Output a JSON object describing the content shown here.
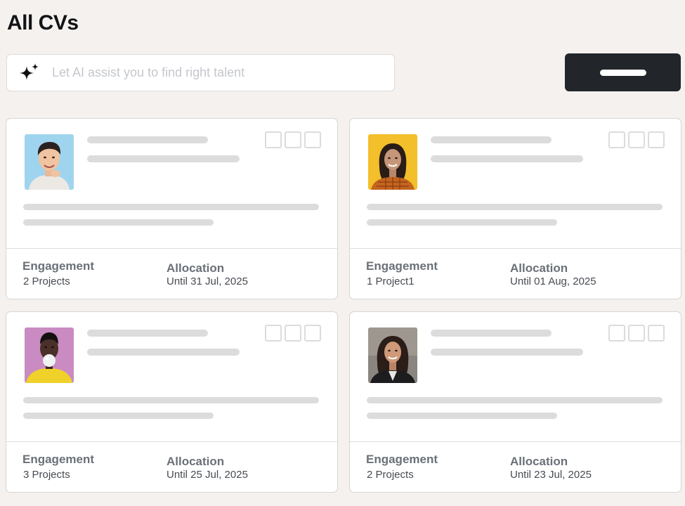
{
  "page": {
    "title": "All CVs"
  },
  "search": {
    "placeholder": "Let AI assist you to find right talent",
    "icon": "sparkle-icon"
  },
  "colors": {
    "background": "#f4f1ee",
    "button": "#222529",
    "skeleton": "#dcdcdc"
  },
  "cards": [
    {
      "engagement_label": "Engagement",
      "engagement_value": "2 Projects",
      "allocation_label": "Allocation",
      "allocation_value": "Until 31 Jul, 2025",
      "avatar_bg": "#9fd4ee"
    },
    {
      "engagement_label": "Engagement",
      "engagement_value": "1 Project1",
      "allocation_label": "Allocation",
      "allocation_value": "Until 01 Aug, 2025",
      "avatar_bg": "#f3bf2a"
    },
    {
      "engagement_label": "Engagement",
      "engagement_value": "3 Projects",
      "allocation_label": "Allocation",
      "allocation_value": "Until 25 Jul, 2025",
      "avatar_bg": "#c98bc1"
    },
    {
      "engagement_label": "Engagement",
      "engagement_value": "2 Projects",
      "allocation_label": "Allocation",
      "allocation_value": "Until 23 Jul, 2025",
      "avatar_bg": "#8a8580"
    }
  ]
}
